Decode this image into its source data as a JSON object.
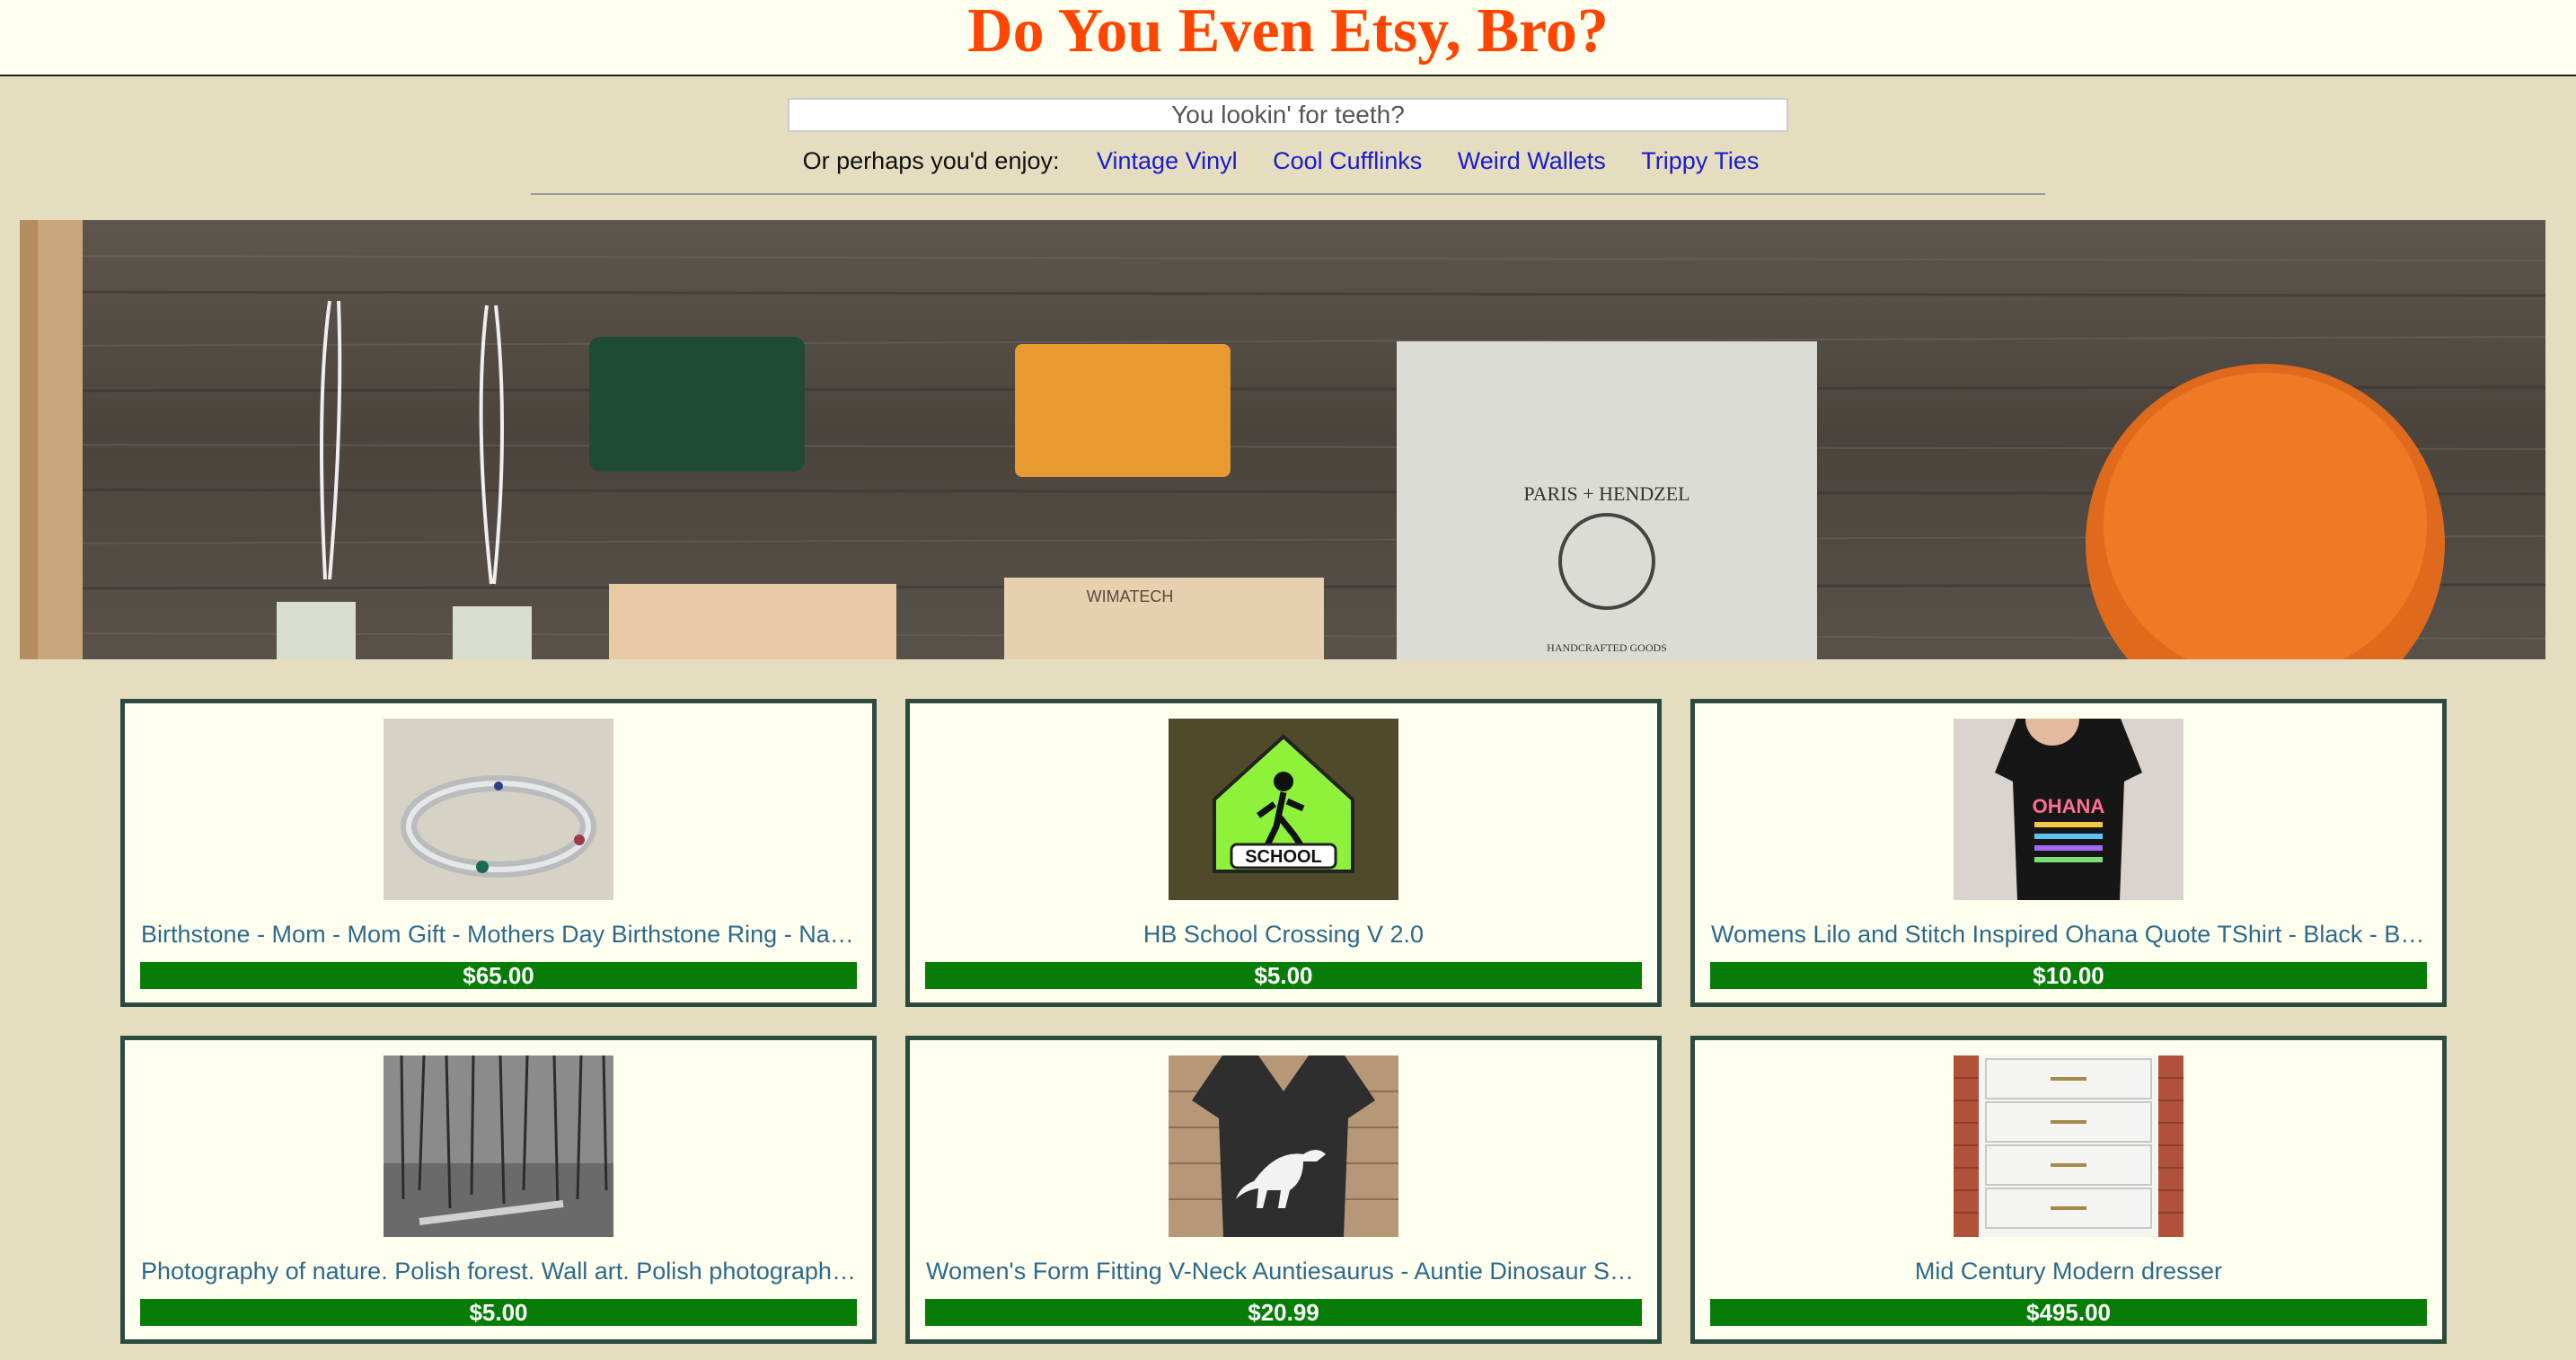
{
  "header": {
    "title": "Do You Even Etsy, Bro?"
  },
  "search": {
    "placeholder": "You lookin' for teeth?"
  },
  "suggestions": {
    "label": "Or perhaps you'd enjoy:",
    "links": [
      "Vintage Vinyl",
      "Cool Cufflinks",
      "Weird Wallets",
      "Trippy Ties"
    ]
  },
  "hero": {
    "box_text": "PARIS + HENDZEL",
    "box_subtext": "HANDCRAFTED GOODS",
    "block_text": "WIMATECH"
  },
  "products": [
    {
      "title": "Birthstone - Mom - Mom Gift - Mothers Day Birthstone Ring - Name Ring",
      "price": "$65.00"
    },
    {
      "title": "HB School Crossing V 2.0",
      "price": "$5.00",
      "image_text": "SCHOOL"
    },
    {
      "title": "Womens Lilo and Stitch Inspired Ohana Quote TShirt - Black - Blue Tee",
      "price": "$10.00",
      "image_text": "OHANA"
    },
    {
      "title": "Photography of nature. Polish forest. Wall art. Polish photography. Print",
      "price": "$5.00"
    },
    {
      "title": "Women's Form Fitting V-Neck Auntiesaurus - Auntie Dinosaur Shirt - Tee",
      "price": "$20.99"
    },
    {
      "title": "Mid Century Modern dresser",
      "price": "$495.00"
    }
  ],
  "colors": {
    "title": "#ff4500",
    "price_bar": "#067d06",
    "card_border": "#2c4b3f",
    "link": "#1a1ad0"
  }
}
